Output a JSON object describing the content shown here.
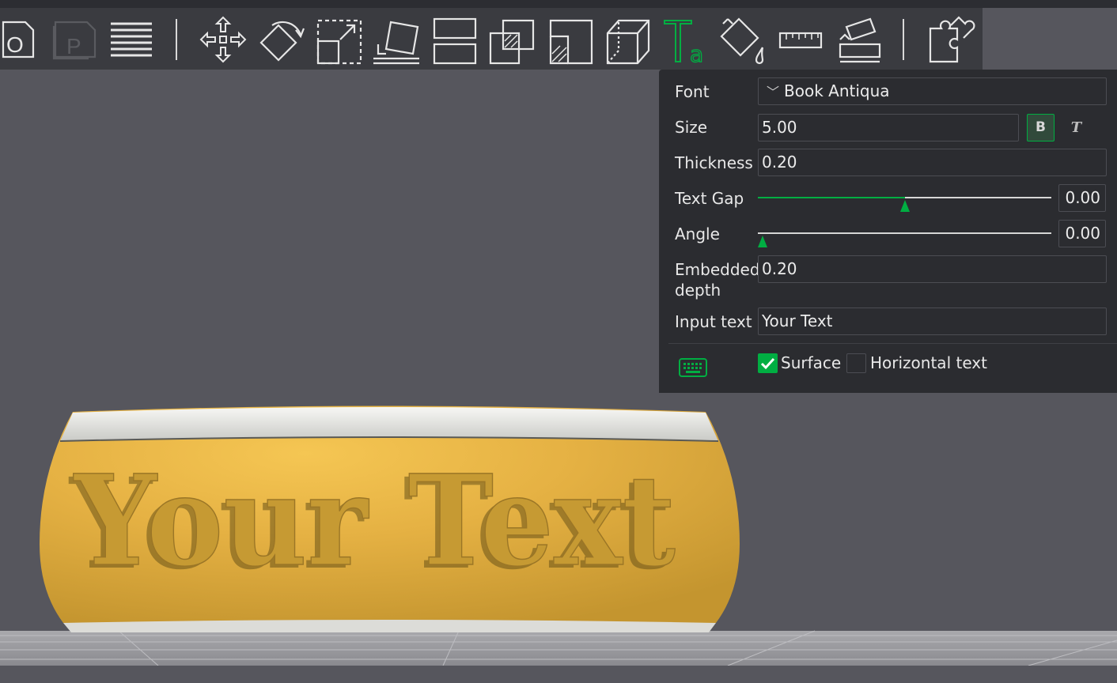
{
  "toolbar": {
    "tools": [
      {
        "name": "orient-icon",
        "glyph": "O"
      },
      {
        "name": "plate-icon",
        "glyph": "P"
      },
      {
        "name": "arrange-icon"
      },
      {
        "name": "move-icon"
      },
      {
        "name": "rotate-icon"
      },
      {
        "name": "scale-icon"
      },
      {
        "name": "lay-on-face-icon"
      },
      {
        "name": "split-icon"
      },
      {
        "name": "cut-icon"
      },
      {
        "name": "boolean-icon"
      },
      {
        "name": "seam-icon"
      },
      {
        "name": "text-icon",
        "glyph_main": "T",
        "glyph_sub": "a"
      },
      {
        "name": "paint-icon"
      },
      {
        "name": "measure-icon"
      },
      {
        "name": "assembly-icon"
      },
      {
        "name": "puzzle-icon"
      }
    ],
    "accent_color": "#00ae42"
  },
  "text_panel": {
    "font": {
      "label": "Font",
      "value": "Book Antiqua"
    },
    "size": {
      "label": "Size",
      "value": "5.00",
      "bold_label": "B",
      "italic_label": "T"
    },
    "thickness": {
      "label": "Thickness",
      "value": "0.20"
    },
    "text_gap": {
      "label": "Text Gap",
      "value": "0.00",
      "level": 0.5
    },
    "angle": {
      "label": "Angle",
      "value": "0.00",
      "level": 0.0
    },
    "embedded_depth": {
      "label_line1": "Embedded",
      "label_line2": "depth",
      "value": "0.20"
    },
    "input_text": {
      "label": "Input text",
      "value": "Your Text"
    },
    "surface": {
      "label": "Surface",
      "checked": true
    },
    "horizontal_text": {
      "label": "Horizontal text",
      "checked": false
    },
    "keyboard_icon": "keyboard-icon"
  },
  "viewport": {
    "model_text": "Your Text",
    "model_color": "#e8b548"
  }
}
